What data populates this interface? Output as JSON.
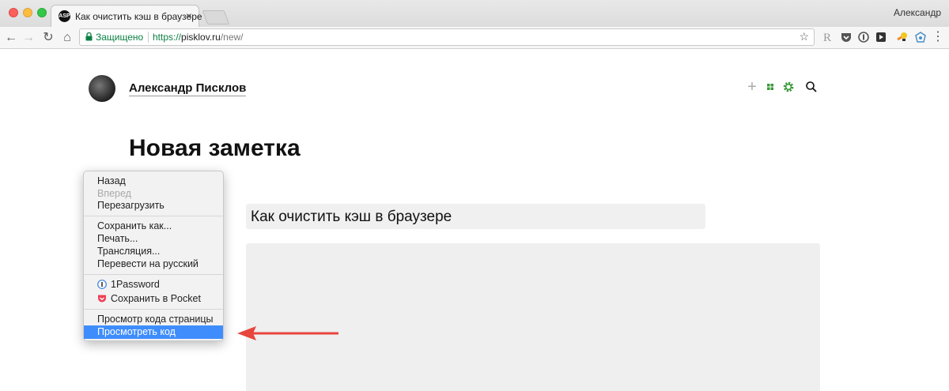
{
  "window": {
    "tab_title": "Как очистить кэш в браузере",
    "tab_favicon_text": "ASP",
    "profile_name": "Александр"
  },
  "toolbar": {
    "secure_label": "Защищено",
    "url_scheme": "https://",
    "url_host": "pisklov.ru",
    "url_path": "/new/"
  },
  "page": {
    "site_name": "Александр Писклов",
    "heading": "Новая заметка",
    "title_input_value": "Как очистить кэш в браузере",
    "body_value": ""
  },
  "context_menu": {
    "items": [
      {
        "label": "Назад",
        "disabled": false
      },
      {
        "label": "Вперед",
        "disabled": true
      },
      {
        "label": "Перезагрузить",
        "disabled": false
      },
      {
        "label": "Сохранить как...",
        "disabled": false
      },
      {
        "label": "Печать...",
        "disabled": false
      },
      {
        "label": "Трансляция...",
        "disabled": false
      },
      {
        "label": "Перевести на русский",
        "disabled": false
      },
      {
        "label": "1Password",
        "icon": "1password-icon"
      },
      {
        "label": "Сохранить в Pocket",
        "icon": "pocket-icon"
      },
      {
        "label": "Просмотр кода страницы",
        "disabled": false
      },
      {
        "label": "Просмотреть код",
        "highlighted": true
      }
    ]
  },
  "colors": {
    "secure_green": "#0b8043",
    "menu_highlight": "#3f8dfd",
    "arrow_red": "#e8453c",
    "header_icon_green": "#3a9a3a"
  }
}
